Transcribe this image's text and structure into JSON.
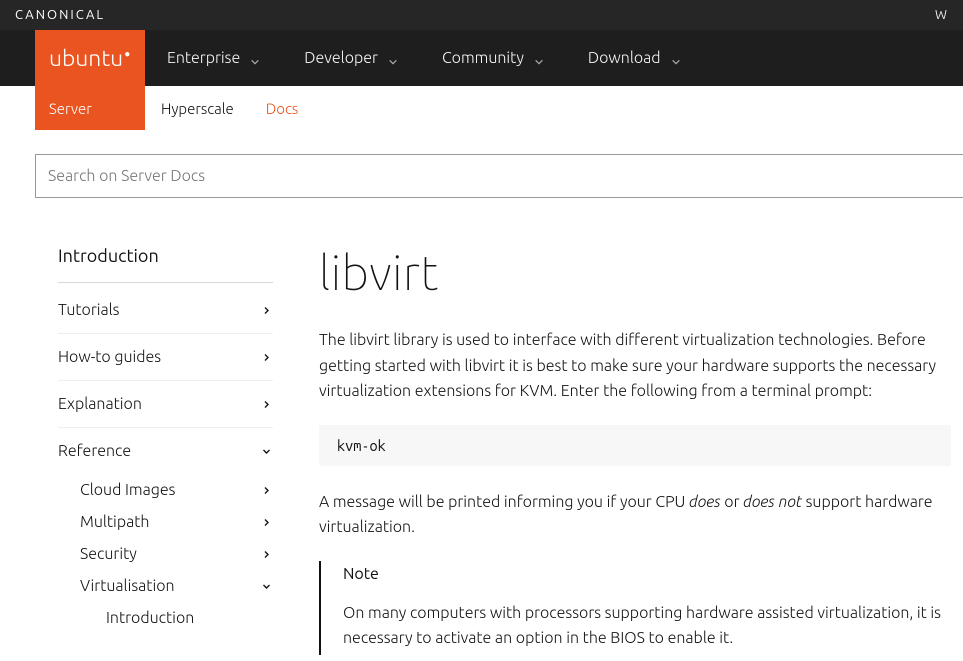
{
  "top": {
    "brand": "CANONICAL",
    "right": "W"
  },
  "logo": "ubuntu",
  "nav": [
    {
      "label": "Enterprise"
    },
    {
      "label": "Developer"
    },
    {
      "label": "Community"
    },
    {
      "label": "Download"
    }
  ],
  "subnav": {
    "active": "Server",
    "items": [
      "Hyperscale",
      "Docs"
    ],
    "orange_index": 1
  },
  "search": {
    "placeholder": "Search on Server Docs"
  },
  "sidebar": {
    "heading": "Introduction",
    "sections": [
      {
        "label": "Tutorials",
        "chevron": "right"
      },
      {
        "label": "How-to guides",
        "chevron": "right"
      },
      {
        "label": "Explanation",
        "chevron": "right"
      },
      {
        "label": "Reference",
        "chevron": "down",
        "children": [
          {
            "label": "Cloud Images",
            "chevron": "right"
          },
          {
            "label": "Multipath",
            "chevron": "right"
          },
          {
            "label": "Security",
            "chevron": "right"
          },
          {
            "label": "Virtualisation",
            "chevron": "down",
            "children": [
              {
                "label": "Introduction"
              }
            ]
          }
        ]
      }
    ]
  },
  "page": {
    "title": "libvirt",
    "intro": "The libvirt library is used to interface with different virtualization technologies. Before getting started with libvirt it is best to make sure your hardware supports the necessary virtualization extensions for KVM. Enter the following from a terminal prompt:",
    "code1": "kvm-ok",
    "result_pre": "A message will be printed informing you if your CPU ",
    "result_em1": "does",
    "result_mid": " or ",
    "result_em2": "does not",
    "result_post": " support hardware virtualization.",
    "note": {
      "title": "Note",
      "body": "On many computers with processors supporting hardware assisted virtualization, it is necessary to activate an option in the BIOS to enable it."
    }
  }
}
